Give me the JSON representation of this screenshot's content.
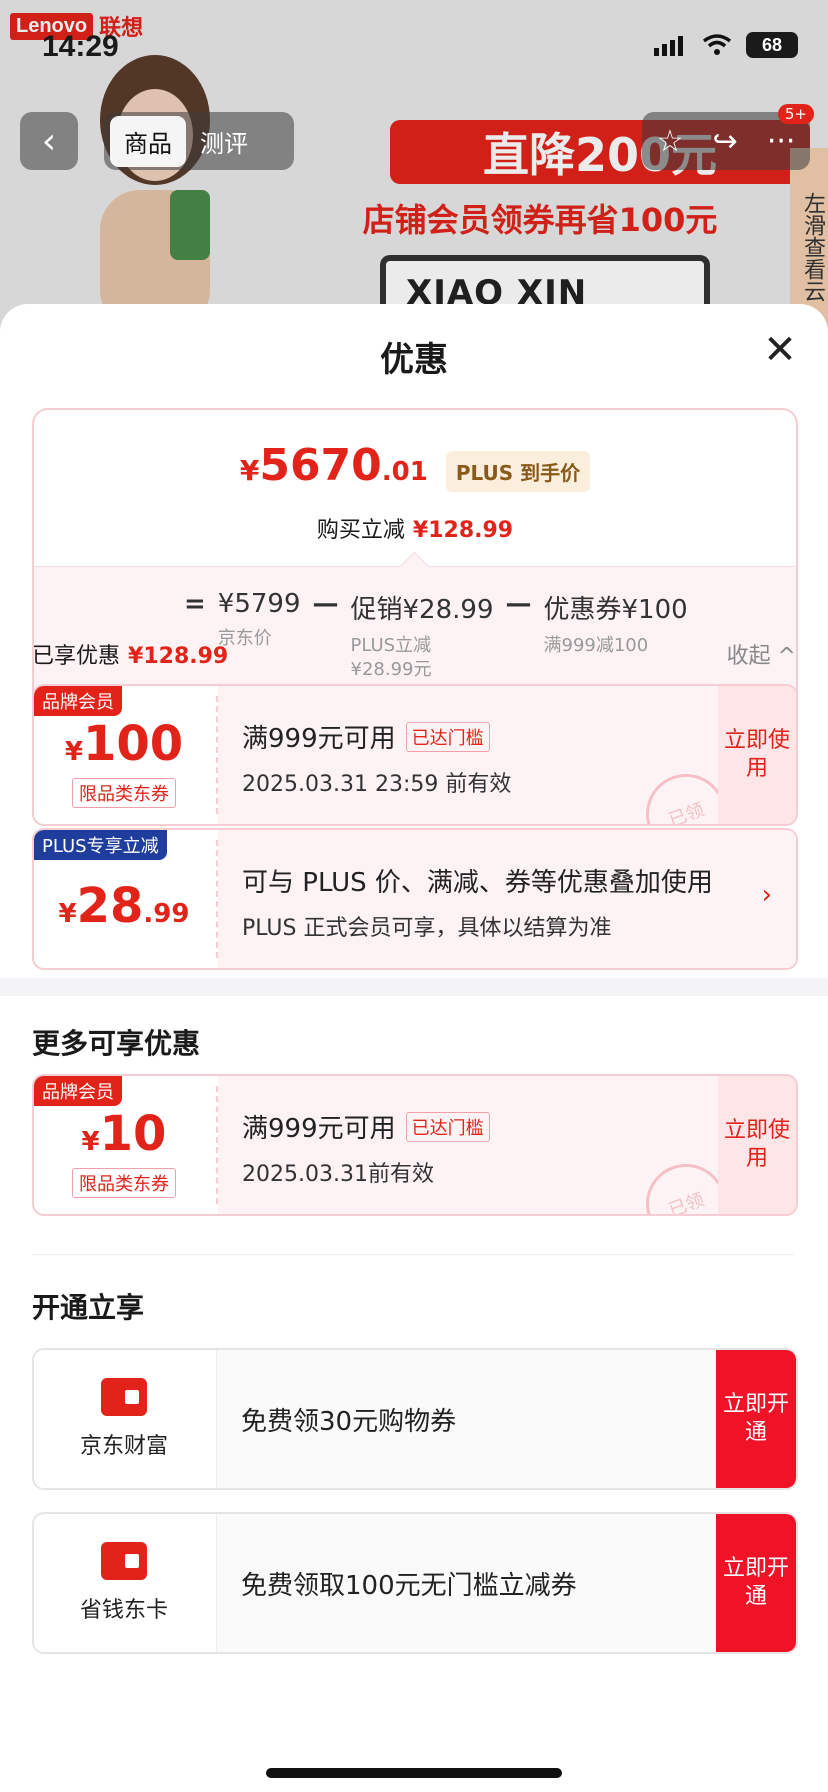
{
  "status_bar": {
    "time": "14:29",
    "battery": "68"
  },
  "background": {
    "brand_logo": "Lenovo",
    "brand_cn": "联想",
    "banner_main": "直降200元",
    "banner_sub": "店铺会员领券再省100元",
    "laptop_text": "XIAO XIN",
    "side_hint": "左滑查看云"
  },
  "nav": {
    "tabs": [
      "商品",
      "测评"
    ],
    "message_badge": "5+",
    "icons": [
      "back-icon",
      "star-icon",
      "share-icon",
      "more-icon"
    ]
  },
  "sheet": {
    "title": "优惠",
    "price": {
      "yen": "¥",
      "integer": "5670",
      "decimal": ".01",
      "tag": "PLUS 到手价",
      "reduce_label": "购买立减",
      "reduce_amount": "¥128.99"
    },
    "formula": {
      "eq": "=",
      "minus": "—",
      "jd_price": "¥5799",
      "jd_price_label": "京东价",
      "promo": "促销¥28.99",
      "promo_sub1": "PLUS立减",
      "promo_sub2": "¥28.99元",
      "coupon": "优惠券¥100",
      "coupon_sub": "满999减100"
    },
    "enjoyed_label": "已享优惠",
    "enjoyed_amount": "¥128.99",
    "collapse_label": "收起 ^",
    "coupons": [
      {
        "tag": "品牌会员",
        "yen": "¥",
        "amount": "100",
        "scope": "限品类东券",
        "condition": "满999元可用",
        "status": "已达门槛",
        "validity": "2025.03.31 23:59 前有效",
        "action": "立即使用",
        "stamp": "已领"
      }
    ],
    "plus_reduce": {
      "tag": "PLUS专享立减",
      "yen": "¥",
      "amount": "28",
      "decimal": ".99",
      "title": "可与 PLUS 价、满减、券等优惠叠加使用",
      "desc": "PLUS 正式会员可享，具体以结算为准",
      "arrow": "›"
    },
    "more_title": "更多可享优惠",
    "more_coupons": [
      {
        "tag": "品牌会员",
        "yen": "¥",
        "amount": "10",
        "scope": "限品类东券",
        "condition": "满999元可用",
        "status": "已达门槛",
        "validity": "2025.03.31前有效",
        "action": "立即使用",
        "stamp": "已领"
      }
    ],
    "open_title": "开通立享",
    "open_items": [
      {
        "name": "京东财富",
        "desc": "免费领30元购物券",
        "action": "立即开通"
      },
      {
        "name": "省钱东卡",
        "desc": "免费领取100元无门槛立减券",
        "action": "立即开通"
      }
    ]
  },
  "colors": {
    "accent": "#e2231a",
    "plus_blue": "#1f3d9c",
    "open_red": "#f01328"
  }
}
